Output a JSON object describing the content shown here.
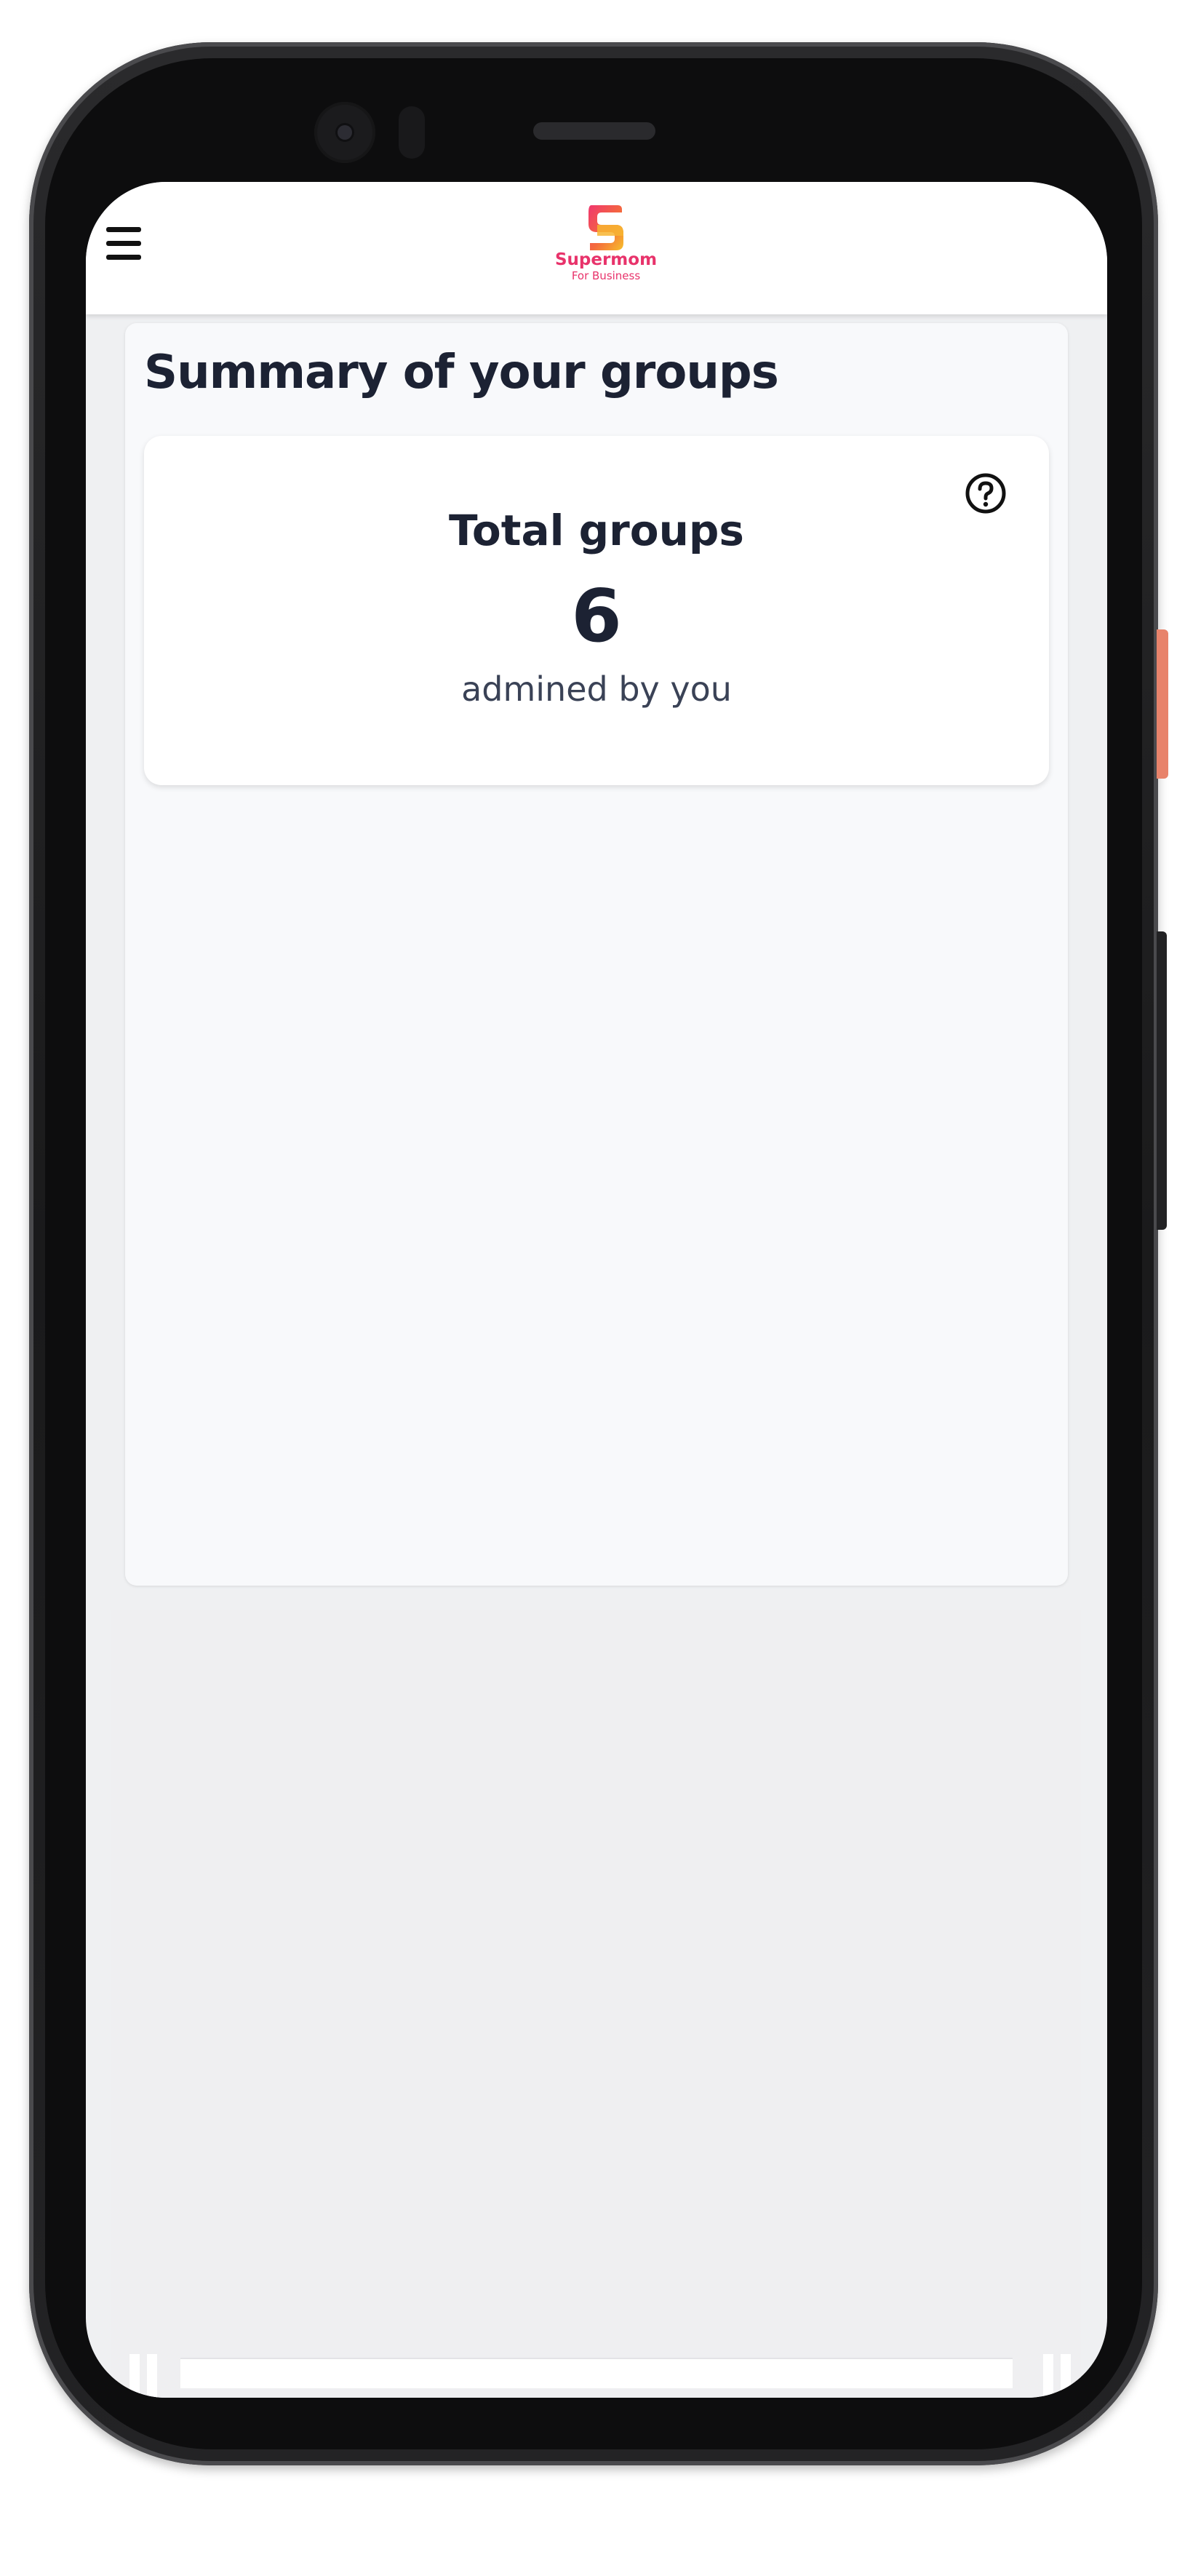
{
  "app": {
    "brand_name": "Supermom",
    "brand_sub": "For Business",
    "brand_color": "#e8336b"
  },
  "header": {
    "menu_icon": "hamburger-menu-icon"
  },
  "summary": {
    "title": "Summary of your groups",
    "card": {
      "title": "Total groups",
      "value": "6",
      "caption": "admined by you",
      "help_icon": "question-circle-icon"
    }
  }
}
